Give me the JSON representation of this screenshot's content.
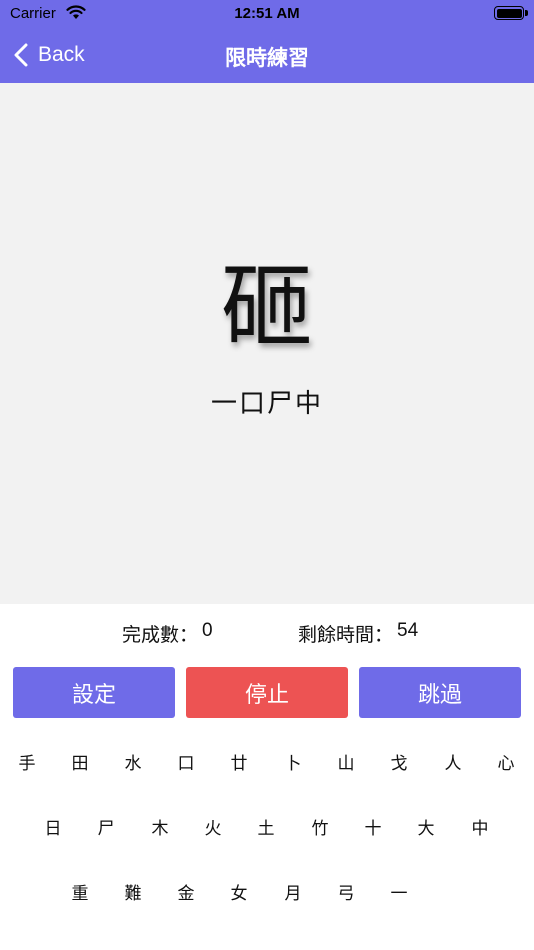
{
  "status_bar": {
    "carrier": "Carrier",
    "time": "12:51 AM"
  },
  "nav": {
    "back_label": "Back",
    "title": "限時練習"
  },
  "practice": {
    "character": "砸",
    "code": "一口尸中"
  },
  "stats": {
    "completed_label": "完成數：",
    "completed_value": "0",
    "remaining_label": "剩餘時間：",
    "remaining_value": "54"
  },
  "buttons": {
    "settings": "設定",
    "stop": "停止",
    "skip": "跳過"
  },
  "keyboard": {
    "row1": [
      "手",
      "田",
      "水",
      "口",
      "廿",
      "卜",
      "山",
      "戈",
      "人",
      "心"
    ],
    "row2": [
      "日",
      "尸",
      "木",
      "火",
      "土",
      "竹",
      "十",
      "大",
      "中"
    ],
    "row3": [
      "重",
      "難",
      "金",
      "女",
      "月",
      "弓",
      "一"
    ]
  },
  "colors": {
    "primary": "#6f6be8",
    "stop": "#ed5353",
    "background": "#f2f2f2"
  }
}
